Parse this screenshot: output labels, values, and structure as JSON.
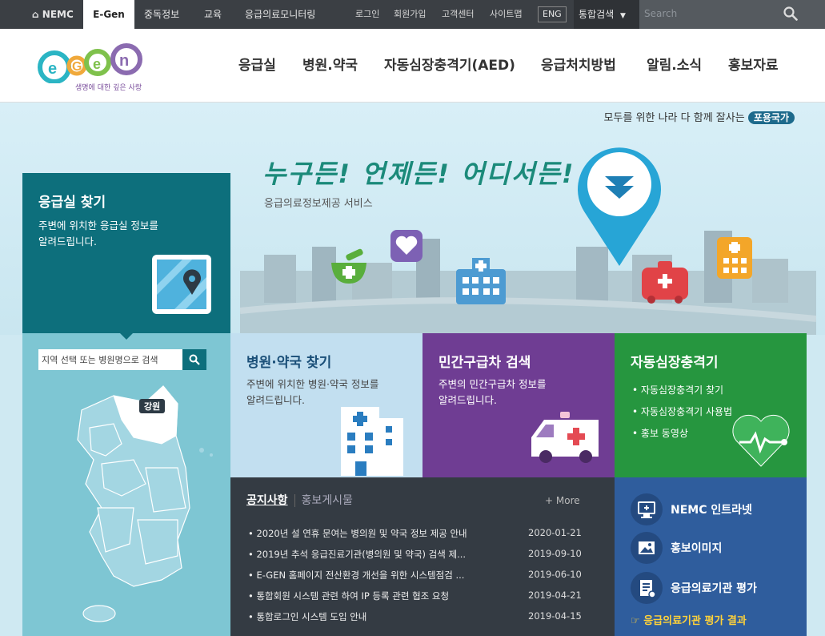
{
  "topbar": {
    "nemc": "NEMC",
    "egen": "E-Gen",
    "menu": [
      "중독정보",
      "교육",
      "응급의료모니터링"
    ],
    "util": [
      "로그인",
      "회원가입",
      "고객센터",
      "사이트맵"
    ],
    "eng": "ENG",
    "total_search": "통합검색",
    "search_placeholder": "Search"
  },
  "header": {
    "logo_subtitle": "생명에 대한 깊은 사랑",
    "nav": [
      "응급실",
      "병원.약국",
      "자동심장충격기(AED)",
      "응급처치방법",
      "알림.소식",
      "홍보자료"
    ]
  },
  "hero": {
    "slogan": "모두를 위한 나라 다 함께 잘사는",
    "slogan_tag": "포용국가",
    "title": "누구든! 언제든! 어디서든!",
    "subtitle": "응급의료정보제공 서비스"
  },
  "er_tile": {
    "title": "응급실 찾기",
    "desc_line1": "주변에 위치한 응급실 정보를",
    "desc_line2": "알려드립니다."
  },
  "map_tile": {
    "search_placeholder": "지역 선택 또는 병원명으로 검색",
    "region_label": "강원"
  },
  "hosp_tile": {
    "title": "병원·약국 찾기",
    "desc_line1": "주변에 위치한 병원·약국 정보를",
    "desc_line2": "알려드립니다."
  },
  "amb_tile": {
    "title": "민간구급차 검색",
    "desc_line1": "주변의 민간구급차 정보를",
    "desc_line2": "알려드립니다."
  },
  "aed_tile": {
    "title": "자동심장충격기",
    "items": [
      "자동심장충격기 찾기",
      "자동심장충격기 사용법",
      "홍보 동영상"
    ]
  },
  "notice": {
    "tab_active": "공지사항",
    "tab_inactive": "홍보게시물",
    "more": "More",
    "rows": [
      {
        "title": "2020년 설 연휴 문여는 병의원 및 약국 정보 제공 안내",
        "date": "2020-01-21"
      },
      {
        "title": "2019년 추석 응급진료기관(병의원 및 약국) 검색 제...",
        "date": "2019-09-10"
      },
      {
        "title": "E-GEN 홈페이지 전산환경 개선을 위한 시스템점검 ...",
        "date": "2019-06-10"
      },
      {
        "title": "통합회원 시스템 관련 하여 IP 등록 관련 협조 요청",
        "date": "2019-04-21"
      },
      {
        "title": "통합로그인 시스템 도입 안내",
        "date": "2019-04-15"
      }
    ]
  },
  "links": {
    "items": [
      "NEMC 인트라넷",
      "홍보이미지",
      "응급의료기관 평가"
    ],
    "result": "응급의료기관 평가 결과"
  }
}
